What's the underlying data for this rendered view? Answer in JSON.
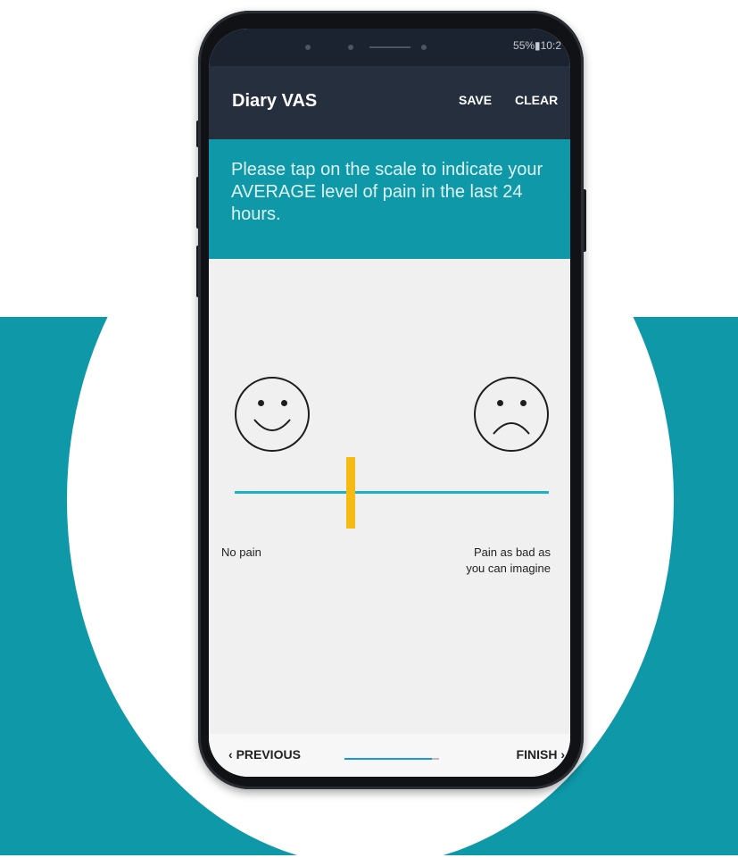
{
  "status_bar": {
    "text": "55%▮10:2"
  },
  "app_bar": {
    "title": "Diary VAS",
    "save_label": "SAVE",
    "clear_label": "CLEAR"
  },
  "prompt": {
    "text": "Please tap on the scale to indicate your AVERAGE level of pain in the last 24 hours."
  },
  "scale": {
    "left_icon": "smiling-face-icon",
    "right_icon": "frowning-face-icon",
    "left_label": "No pain",
    "right_label_line1": "Pain as bad as",
    "right_label_line2": "you can imagine",
    "selected_value": 0.37
  },
  "navigation": {
    "previous_label": "PREVIOUS",
    "finish_label": "FINISH",
    "progress": 0.92
  },
  "colors": {
    "teal": "#0e98a8",
    "app_bar": "#252f3d",
    "scale_line": "#1bb2c6",
    "marker": "#f5bb12",
    "progress": "#1a97e0"
  }
}
